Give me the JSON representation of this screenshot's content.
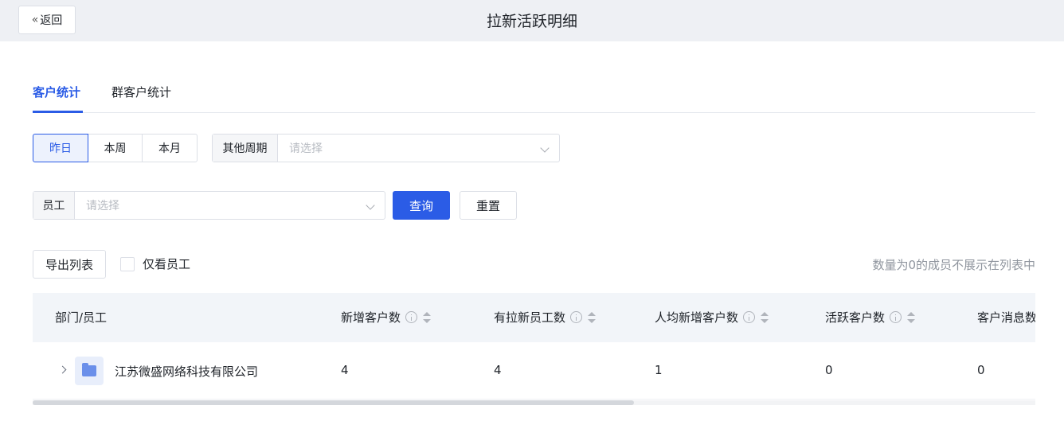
{
  "header": {
    "back_label": "返回",
    "title": "拉新活跃明细"
  },
  "tabs": [
    {
      "label": "客户统计",
      "active": true
    },
    {
      "label": "群客户统计",
      "active": false
    }
  ],
  "period": {
    "options": [
      {
        "label": "昨日",
        "active": true
      },
      {
        "label": "本周",
        "active": false
      },
      {
        "label": "本月",
        "active": false
      }
    ],
    "other_label": "其他周期",
    "other_placeholder": "请选择"
  },
  "filter": {
    "employee_label": "员工",
    "employee_placeholder": "请选择",
    "query_label": "查询",
    "reset_label": "重置"
  },
  "toolbar": {
    "export_label": "导出列表",
    "only_staff_label": "仅看员工",
    "only_staff_checked": false,
    "hint": "数量为0的成员不展示在列表中"
  },
  "table": {
    "columns": [
      "部门/员工",
      "新增客户数",
      "有拉新员工数",
      "人均新增客户数",
      "活跃客户数",
      "客户消息数"
    ],
    "rows": [
      {
        "name": "江苏微盛网络科技有限公司",
        "values": [
          "4",
          "4",
          "1",
          "0",
          "0"
        ]
      }
    ],
    "scroll_fraction": 0.6
  },
  "colors": {
    "primary": "#2b5ce6",
    "header_bg": "#eef0f4",
    "table_head_bg": "#f2f5f9"
  }
}
